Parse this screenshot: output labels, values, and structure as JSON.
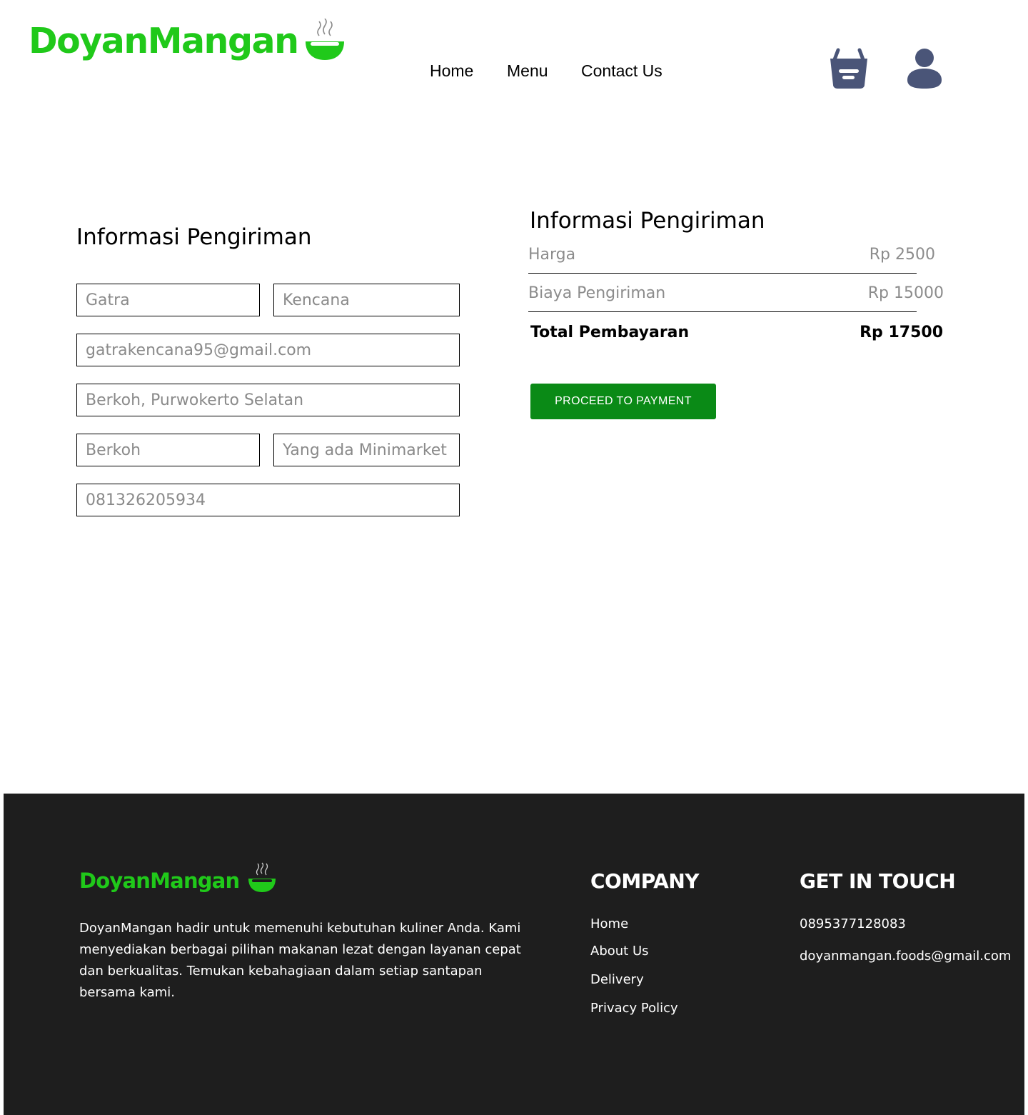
{
  "header": {
    "brand": "DoyanMangan",
    "nav": [
      "Home",
      "Menu",
      "Contact Us"
    ],
    "icons": [
      "basket-icon",
      "user-icon"
    ],
    "icon_color": "#4a5578",
    "brand_color": "#20c91a"
  },
  "form": {
    "title": "Informasi Pengiriman",
    "first_name": "Gatra",
    "last_name": "Kencana",
    "email": "gatrakencana95@gmail.com",
    "address": "Berkoh, Purwokerto Selatan",
    "village": "Berkoh",
    "landmark": "Yang ada Minimarket",
    "phone": "081326205934"
  },
  "summary": {
    "title": "Informasi Pengiriman",
    "price_label": "Harga",
    "price_value": "Rp 2500",
    "shipping_label": "Biaya Pengiriman",
    "shipping_value": "Rp 15000",
    "total_label": "Total Pembayaran",
    "total_value": "Rp 17500",
    "button_label": "PROCEED TO PAYMENT",
    "button_color": "#0a8a16"
  },
  "footer": {
    "brand": "DoyanMangan",
    "description": "DoyanMangan hadir untuk memenuhi kebutuhan kuliner Anda. Kami menyediakan berbagai pilihan makanan lezat dengan layanan cepat dan berkualitas. Temukan kebahagiaan dalam setiap santapan bersama kami.",
    "company_heading": "COMPANY",
    "company_links": [
      "Home",
      "About Us",
      "Delivery",
      "Privacy Policy"
    ],
    "contact_heading": "GET IN TOUCH",
    "phone": "0895377128083",
    "email": "doyanmangan.foods@gmail.com",
    "background": "#1e1e1e"
  }
}
